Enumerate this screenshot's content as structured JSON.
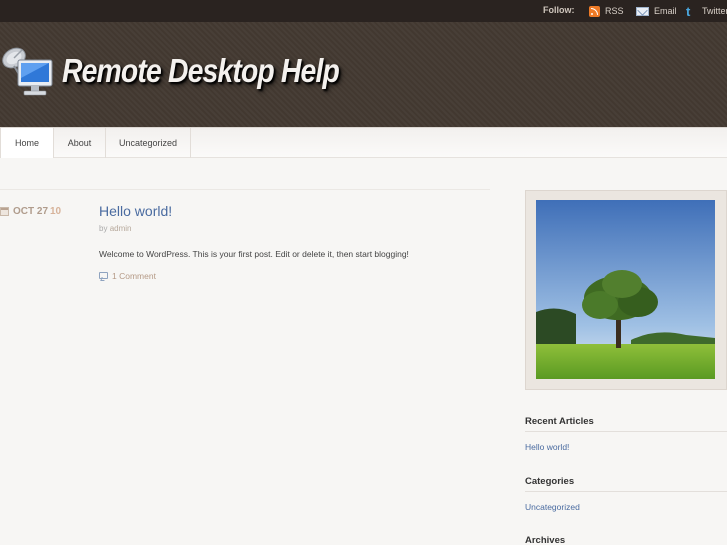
{
  "topbar": {
    "follow_label": "Follow:",
    "links": [
      {
        "label": "RSS",
        "icon": "rss-icon"
      },
      {
        "label": "Email",
        "icon": "email-icon"
      },
      {
        "label": "Twitter",
        "icon": "twitter-icon"
      }
    ]
  },
  "header": {
    "site_title": "Remote Desktop Help",
    "logo_icon": "satellite-computer-icon"
  },
  "nav": {
    "items": [
      {
        "label": "Home",
        "active": true
      },
      {
        "label": "About"
      },
      {
        "label": "Uncategorized"
      }
    ]
  },
  "post": {
    "date": "OCT 27",
    "year": "10",
    "title": "Hello world!",
    "author_prefix": "by",
    "author": "admin",
    "excerpt": "Welcome to WordPress. This is your first post. Edit or delete it, then start blogging!",
    "comments": "1 Comment"
  },
  "sidebar": {
    "image": "tree-in-meadow-photo",
    "widgets": [
      {
        "title": "Recent Articles",
        "links": [
          "Hello world!"
        ]
      },
      {
        "title": "Categories",
        "links": [
          "Uncategorized"
        ]
      },
      {
        "title": "Archives",
        "links": []
      }
    ]
  },
  "colors": {
    "header_bg": "#443a32",
    "topbar_bg": "#2a2320",
    "link": "#4a6ba0",
    "page_bg": "#f7f6f4"
  }
}
